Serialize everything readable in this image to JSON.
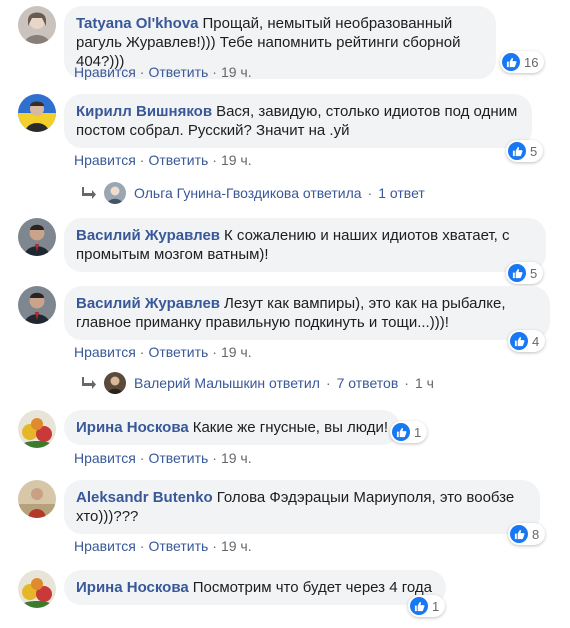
{
  "comments": [
    {
      "author": "Tatyana Ol'khova",
      "text": "Прощай, немытый необразованный рагуль Журавлев!))) Тебе напомнить рейтинги сборной 404?)))",
      "likes": "16",
      "actions": {
        "like": "Нравится",
        "reply": "Ответить",
        "time": "19 ч."
      }
    },
    {
      "author": "Кирилл Вишняков",
      "text": "Вася, завидую, столько идиотов под одним постом собрал. Русский? Значит на .уй",
      "likes": "5",
      "actions": {
        "like": "Нравится",
        "reply": "Ответить",
        "time": "19 ч."
      },
      "replies": {
        "name": "Ольга Гунина-Гвоздикова ответила",
        "count": "1 ответ"
      }
    },
    {
      "author": "Василий Журавлев",
      "text": "К сожалению и наших идиотов хватает, с промытым мозгом ватным)!",
      "likes": "5"
    },
    {
      "author": "Василий Журавлев",
      "text": "Лезут как вампиры), это как на рыбалке, главное приманку правильную подкинуть и тощи...)))!",
      "likes": "4",
      "actions": {
        "like": "Нравится",
        "reply": "Ответить",
        "time": "19 ч."
      },
      "replies": {
        "name": "Валерий Малышкин ответил",
        "count": "7 ответов",
        "time": "1 ч"
      }
    },
    {
      "author": "Ирина Носкова",
      "text": "Какие же гнусные, вы люди!",
      "likes": "1",
      "actions": {
        "like": "Нравится",
        "reply": "Ответить",
        "time": "19 ч."
      }
    },
    {
      "author": "Aleksandr Butenko",
      "text": "Голова Фэдэрацыи Мариуполя, это вообзе хто)))???",
      "likes": "8",
      "actions": {
        "like": "Нравится",
        "reply": "Ответить",
        "time": "19 ч."
      }
    },
    {
      "author": "Ирина Носкова",
      "text": "Посмотрим что будет через 4 года",
      "likes": "1"
    }
  ],
  "colors": {
    "author": "#385898",
    "bubble": "#f2f3f5",
    "like": "#1877f2",
    "meta": "#65676b"
  }
}
